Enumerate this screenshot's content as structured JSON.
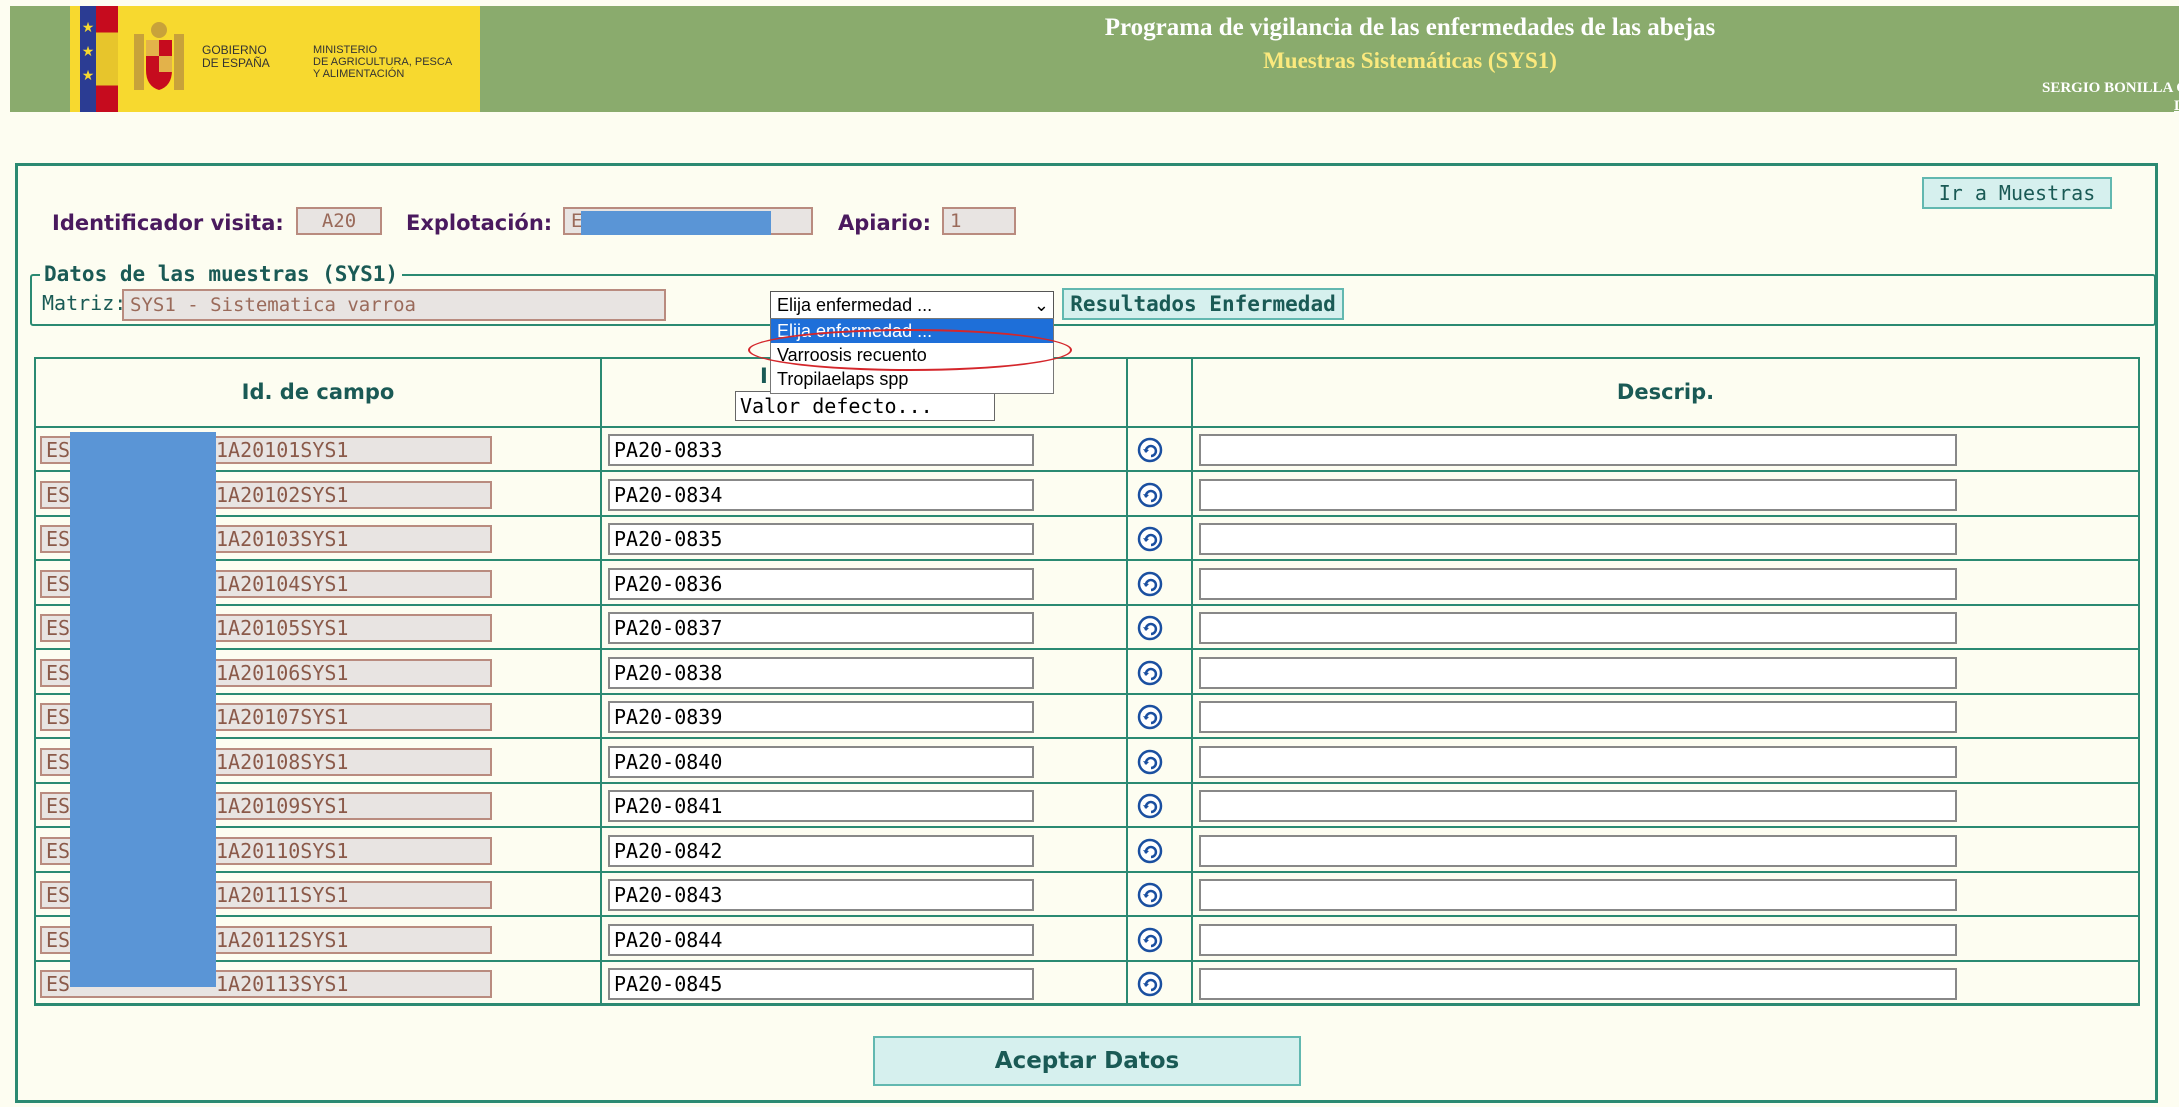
{
  "header": {
    "gobierno": "GOBIERNO\nDE ESPAÑA",
    "ministerio": "MINISTERIO\nDE AGRICULTURA, PESCA\nY ALIMENTACIÓN",
    "title": "Programa de vigilancia de las enfermedades de las abejas",
    "subtitle": "Muestras Sistemáticas (SYS1)",
    "user": "SERGIO BONILLA C",
    "user_link": "De"
  },
  "visit": {
    "id_label": "Identificador visita:",
    "id_value": "A20",
    "explotacion_label": "Explotación:",
    "explotacion_value": "E",
    "apiario_label": "Apiario:",
    "apiario_value": "1",
    "ir_muestras": "Ir a Muestras"
  },
  "samples": {
    "legend": "Datos de las muestras (SYS1)",
    "matriz_label": "Matriz:",
    "matriz_value": "SYS1 - Sistematica varroa",
    "select_value": "Elija enfermedad ...",
    "resultados_btn": "Resultados Enfermedad",
    "options": [
      "Elija enfermedad ...",
      "Varroosis recuento",
      "Tropilaelaps spp"
    ]
  },
  "table": {
    "col_id": "Id. de campo",
    "col_i": "I",
    "col_desc": "Descrip.",
    "valor_defecto": "Valor defecto...",
    "rows": [
      {
        "prefix": "ES",
        "suffix": "1A20101SYS1",
        "value": "PA20-0833"
      },
      {
        "prefix": "ES",
        "suffix": "1A20102SYS1",
        "value": "PA20-0834"
      },
      {
        "prefix": "ES",
        "suffix": "1A20103SYS1",
        "value": "PA20-0835"
      },
      {
        "prefix": "ES",
        "suffix": "1A20104SYS1",
        "value": "PA20-0836"
      },
      {
        "prefix": "ES",
        "suffix": "1A20105SYS1",
        "value": "PA20-0837"
      },
      {
        "prefix": "ES",
        "suffix": "1A20106SYS1",
        "value": "PA20-0838"
      },
      {
        "prefix": "ES",
        "suffix": "1A20107SYS1",
        "value": "PA20-0839"
      },
      {
        "prefix": "ES",
        "suffix": "1A20108SYS1",
        "value": "PA20-0840"
      },
      {
        "prefix": "ES",
        "suffix": "1A20109SYS1",
        "value": "PA20-0841"
      },
      {
        "prefix": "ES",
        "suffix": "1A20110SYS1",
        "value": "PA20-0842"
      },
      {
        "prefix": "ES",
        "suffix": "1A20111SYS1",
        "value": "PA20-0843"
      },
      {
        "prefix": "ES",
        "suffix": "1A20112SYS1",
        "value": "PA20-0844"
      },
      {
        "prefix": "ES",
        "suffix": "1A20113SYS1",
        "value": "PA20-0845"
      }
    ]
  },
  "footer": {
    "aceptar": "Aceptar Datos"
  },
  "colors": {
    "header_bg": "#8aab6d",
    "accent": "#2b8a72",
    "logo_bg": "#f7d92f",
    "redaction": "#5a95d6",
    "annotation": "#d4262b"
  }
}
